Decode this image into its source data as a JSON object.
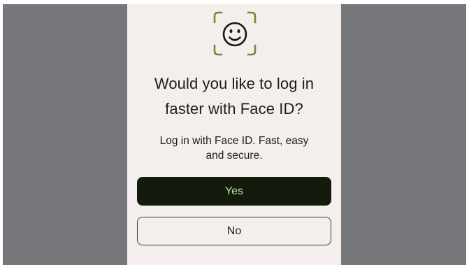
{
  "dialog": {
    "icon": "face-id-icon",
    "title_line1": "Would you like to log in",
    "title_line2": "faster with Face ID?",
    "subtitle_line1": "Log in with Face ID. Fast, easy",
    "subtitle_line2": "and secure."
  },
  "buttons": {
    "yes_label": "Yes",
    "no_label": "No"
  },
  "colors": {
    "backdrop": "#76777b",
    "screen_background": "#f4eeec",
    "primary_button": "#151b0c",
    "primary_button_text": "#b9e29a",
    "icon_bracket": "#6e8a3c",
    "text": "#1b1f17"
  }
}
